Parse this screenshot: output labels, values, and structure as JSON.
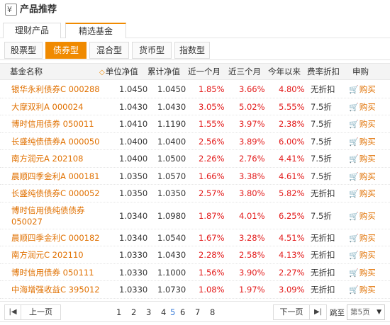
{
  "section_title": "产品推荐",
  "primary_tabs": [
    {
      "label": "理财产品",
      "active": false
    },
    {
      "label": "精选基金",
      "active": true
    }
  ],
  "category_tabs": [
    {
      "label": "股票型",
      "active": false
    },
    {
      "label": "债券型",
      "active": true
    },
    {
      "label": "混合型",
      "active": false
    },
    {
      "label": "货币型",
      "active": false
    },
    {
      "label": "指数型",
      "active": false
    }
  ],
  "table": {
    "headers": {
      "name": "基金名称",
      "nav": "单位净值",
      "acc_nav": "累计净值",
      "m1": "近一个月",
      "m3": "近三个月",
      "ytd": "今年以来",
      "fee": "费率折扣",
      "buy": "申购"
    },
    "sort_indicator": "◇",
    "rows": [
      {
        "name": "银华永利债券C 000288",
        "nav": "1.0450",
        "acc_nav": "1.0450",
        "m1": "1.85%",
        "m3": "3.66%",
        "ytd": "4.80%",
        "fee": "无折扣",
        "buy": "购买"
      },
      {
        "name": "大摩双利A 000024",
        "nav": "1.0430",
        "acc_nav": "1.0430",
        "m1": "3.05%",
        "m3": "5.02%",
        "ytd": "5.55%",
        "fee": "7.5折",
        "buy": "购买"
      },
      {
        "name": "博时信用债券 050011",
        "nav": "1.0410",
        "acc_nav": "1.1190",
        "m1": "1.55%",
        "m3": "3.97%",
        "ytd": "2.38%",
        "fee": "7.5折",
        "buy": "购买"
      },
      {
        "name": "长盛纯债债券A 000050",
        "nav": "1.0400",
        "acc_nav": "1.0400",
        "m1": "2.56%",
        "m3": "3.89%",
        "ytd": "6.00%",
        "fee": "7.5折",
        "buy": "购买"
      },
      {
        "name": "南方润元A 202108",
        "nav": "1.0400",
        "acc_nav": "1.0500",
        "m1": "2.26%",
        "m3": "2.76%",
        "ytd": "4.41%",
        "fee": "7.5折",
        "buy": "购买"
      },
      {
        "name": "晨顺四季金利A 000181",
        "nav": "1.0350",
        "acc_nav": "1.0570",
        "m1": "1.66%",
        "m3": "3.38%",
        "ytd": "4.61%",
        "fee": "7.5折",
        "buy": "购买"
      },
      {
        "name": "长盛纯债债券C 000052",
        "nav": "1.0350",
        "acc_nav": "1.0350",
        "m1": "2.57%",
        "m3": "3.80%",
        "ytd": "5.82%",
        "fee": "无折扣",
        "buy": "购买"
      },
      {
        "name": "博时信用债纯债债券 050027",
        "nav": "1.0340",
        "acc_nav": "1.0980",
        "m1": "1.87%",
        "m3": "4.01%",
        "ytd": "6.25%",
        "fee": "7.5折",
        "buy": "购买",
        "tall": true
      },
      {
        "name": "晨顺四季金利C 000182",
        "nav": "1.0340",
        "acc_nav": "1.0540",
        "m1": "1.67%",
        "m3": "3.28%",
        "ytd": "4.51%",
        "fee": "无折扣",
        "buy": "购买"
      },
      {
        "name": "南方润元C 202110",
        "nav": "1.0330",
        "acc_nav": "1.0430",
        "m1": "2.28%",
        "m3": "2.58%",
        "ytd": "4.13%",
        "fee": "无折扣",
        "buy": "购买"
      },
      {
        "name": "博时信用债券 050111",
        "nav": "1.0330",
        "acc_nav": "1.1000",
        "m1": "1.56%",
        "m3": "3.90%",
        "ytd": "2.27%",
        "fee": "无折扣",
        "buy": "购买"
      },
      {
        "name": "中海增强收益C 395012",
        "nav": "1.0330",
        "acc_nav": "1.0730",
        "m1": "1.08%",
        "m3": "1.97%",
        "ytd": "3.09%",
        "fee": "无折扣",
        "buy": "购买"
      }
    ]
  },
  "pager": {
    "first_icon": "|◀",
    "prev_label": "上一页",
    "pages": [
      "1",
      "2",
      "3",
      "4",
      "5",
      "6",
      "7",
      "8"
    ],
    "current_page": "5",
    "next_label": "下一页",
    "last_icon": "▶|",
    "jump_label": "跳至",
    "jump_value": "第5页"
  },
  "colors": {
    "accent": "#f08a00",
    "link": "#e07000",
    "positive": "#e31b1b",
    "page_active": "#3b7dd8"
  }
}
